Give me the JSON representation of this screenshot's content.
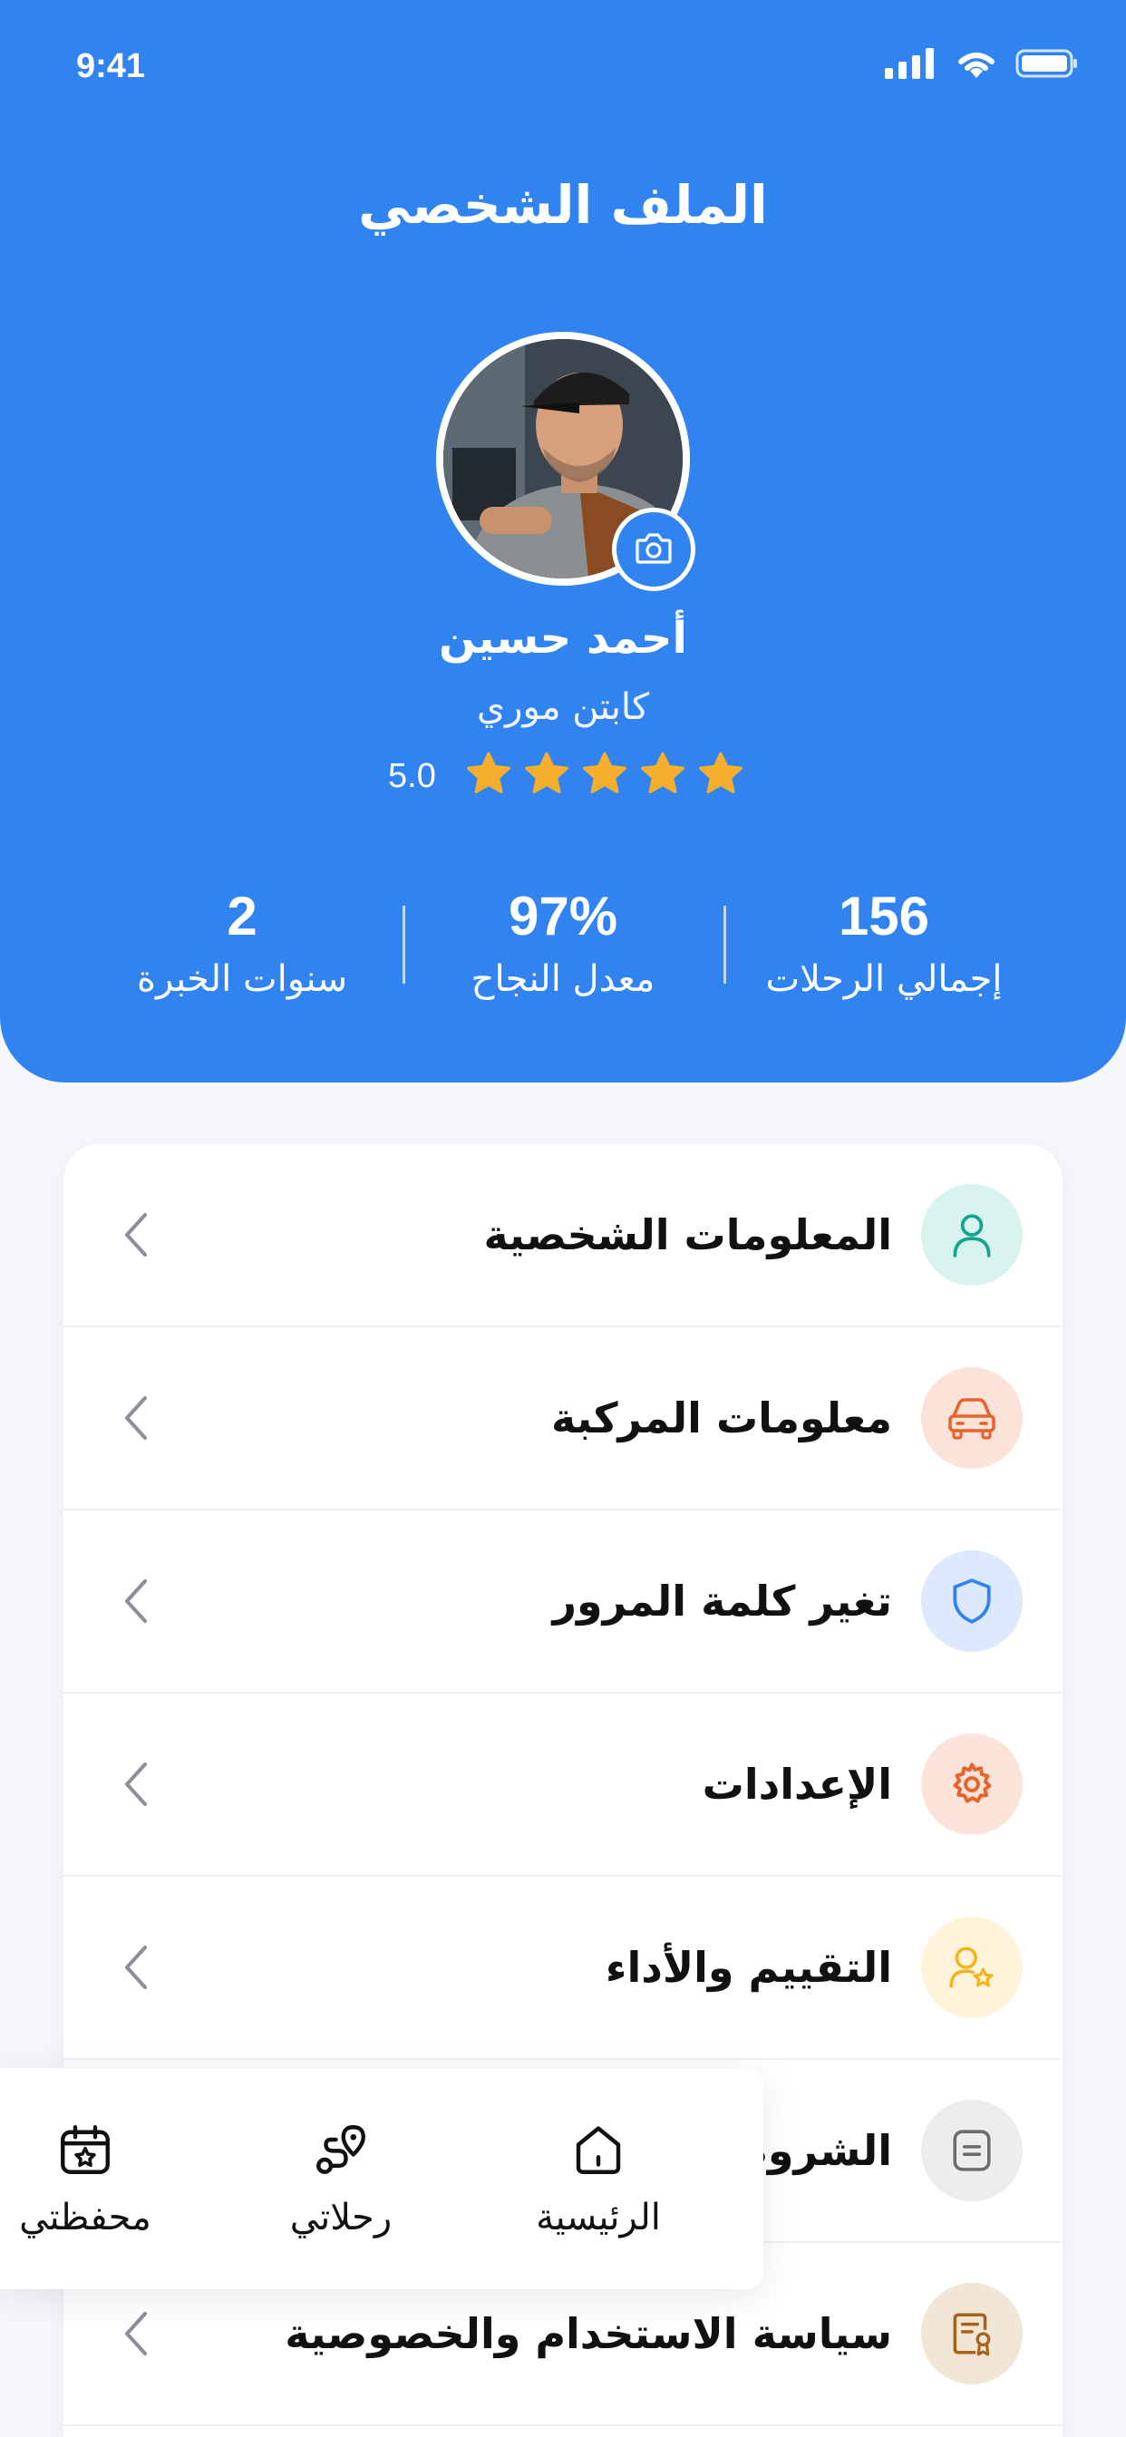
{
  "status_bar": {
    "time": "9:41"
  },
  "header": {
    "title": "الملف الشخصي",
    "name": "أحمد حسين",
    "role": "كابتن موري",
    "rating_value": "5.0",
    "rating_stars": 5
  },
  "stats": [
    {
      "value": "2",
      "label": "سنوات الخبرة"
    },
    {
      "value": "97%",
      "label": "معدل النجاح"
    },
    {
      "value": "156",
      "label": "إجمالي الرحلات"
    }
  ],
  "menu": {
    "items": [
      {
        "label": "المعلومات الشخصية",
        "icon": "user-icon",
        "bg": "#D8F3EE",
        "fg": "#14A38B"
      },
      {
        "label": "معلومات المركبة",
        "icon": "car-icon",
        "bg": "#FCE3DA",
        "fg": "#E8622C"
      },
      {
        "label": "تغير كلمة المرور",
        "icon": "shield-icon",
        "bg": "#DCE9FD",
        "fg": "#3184F0"
      },
      {
        "label": "الإعدادات",
        "icon": "gear-icon",
        "bg": "#FCE3DA",
        "fg": "#E8622C"
      },
      {
        "label": "التقييم والأداء",
        "icon": "user-star-icon",
        "bg": "#FFF4DB",
        "fg": "#F2B31C"
      },
      {
        "label": "الشروط",
        "icon": "document-icon",
        "bg": "#EDEDED",
        "fg": "#6B6B6B"
      },
      {
        "label": "سياسة الاستخدام والخصوصية",
        "icon": "certificate-icon",
        "bg": "#F1E5D6",
        "fg": "#A8631A"
      }
    ]
  },
  "bottom_nav": {
    "items": [
      {
        "label": "الرئيسية",
        "icon": "home-icon"
      },
      {
        "label": "رحلاتي",
        "icon": "route-icon"
      },
      {
        "label": "محفظتي",
        "icon": "wallet-calendar-icon"
      }
    ]
  },
  "colors": {
    "primary": "#3184F0",
    "star": "#F6AE2D",
    "background": "#F6F7FA"
  }
}
